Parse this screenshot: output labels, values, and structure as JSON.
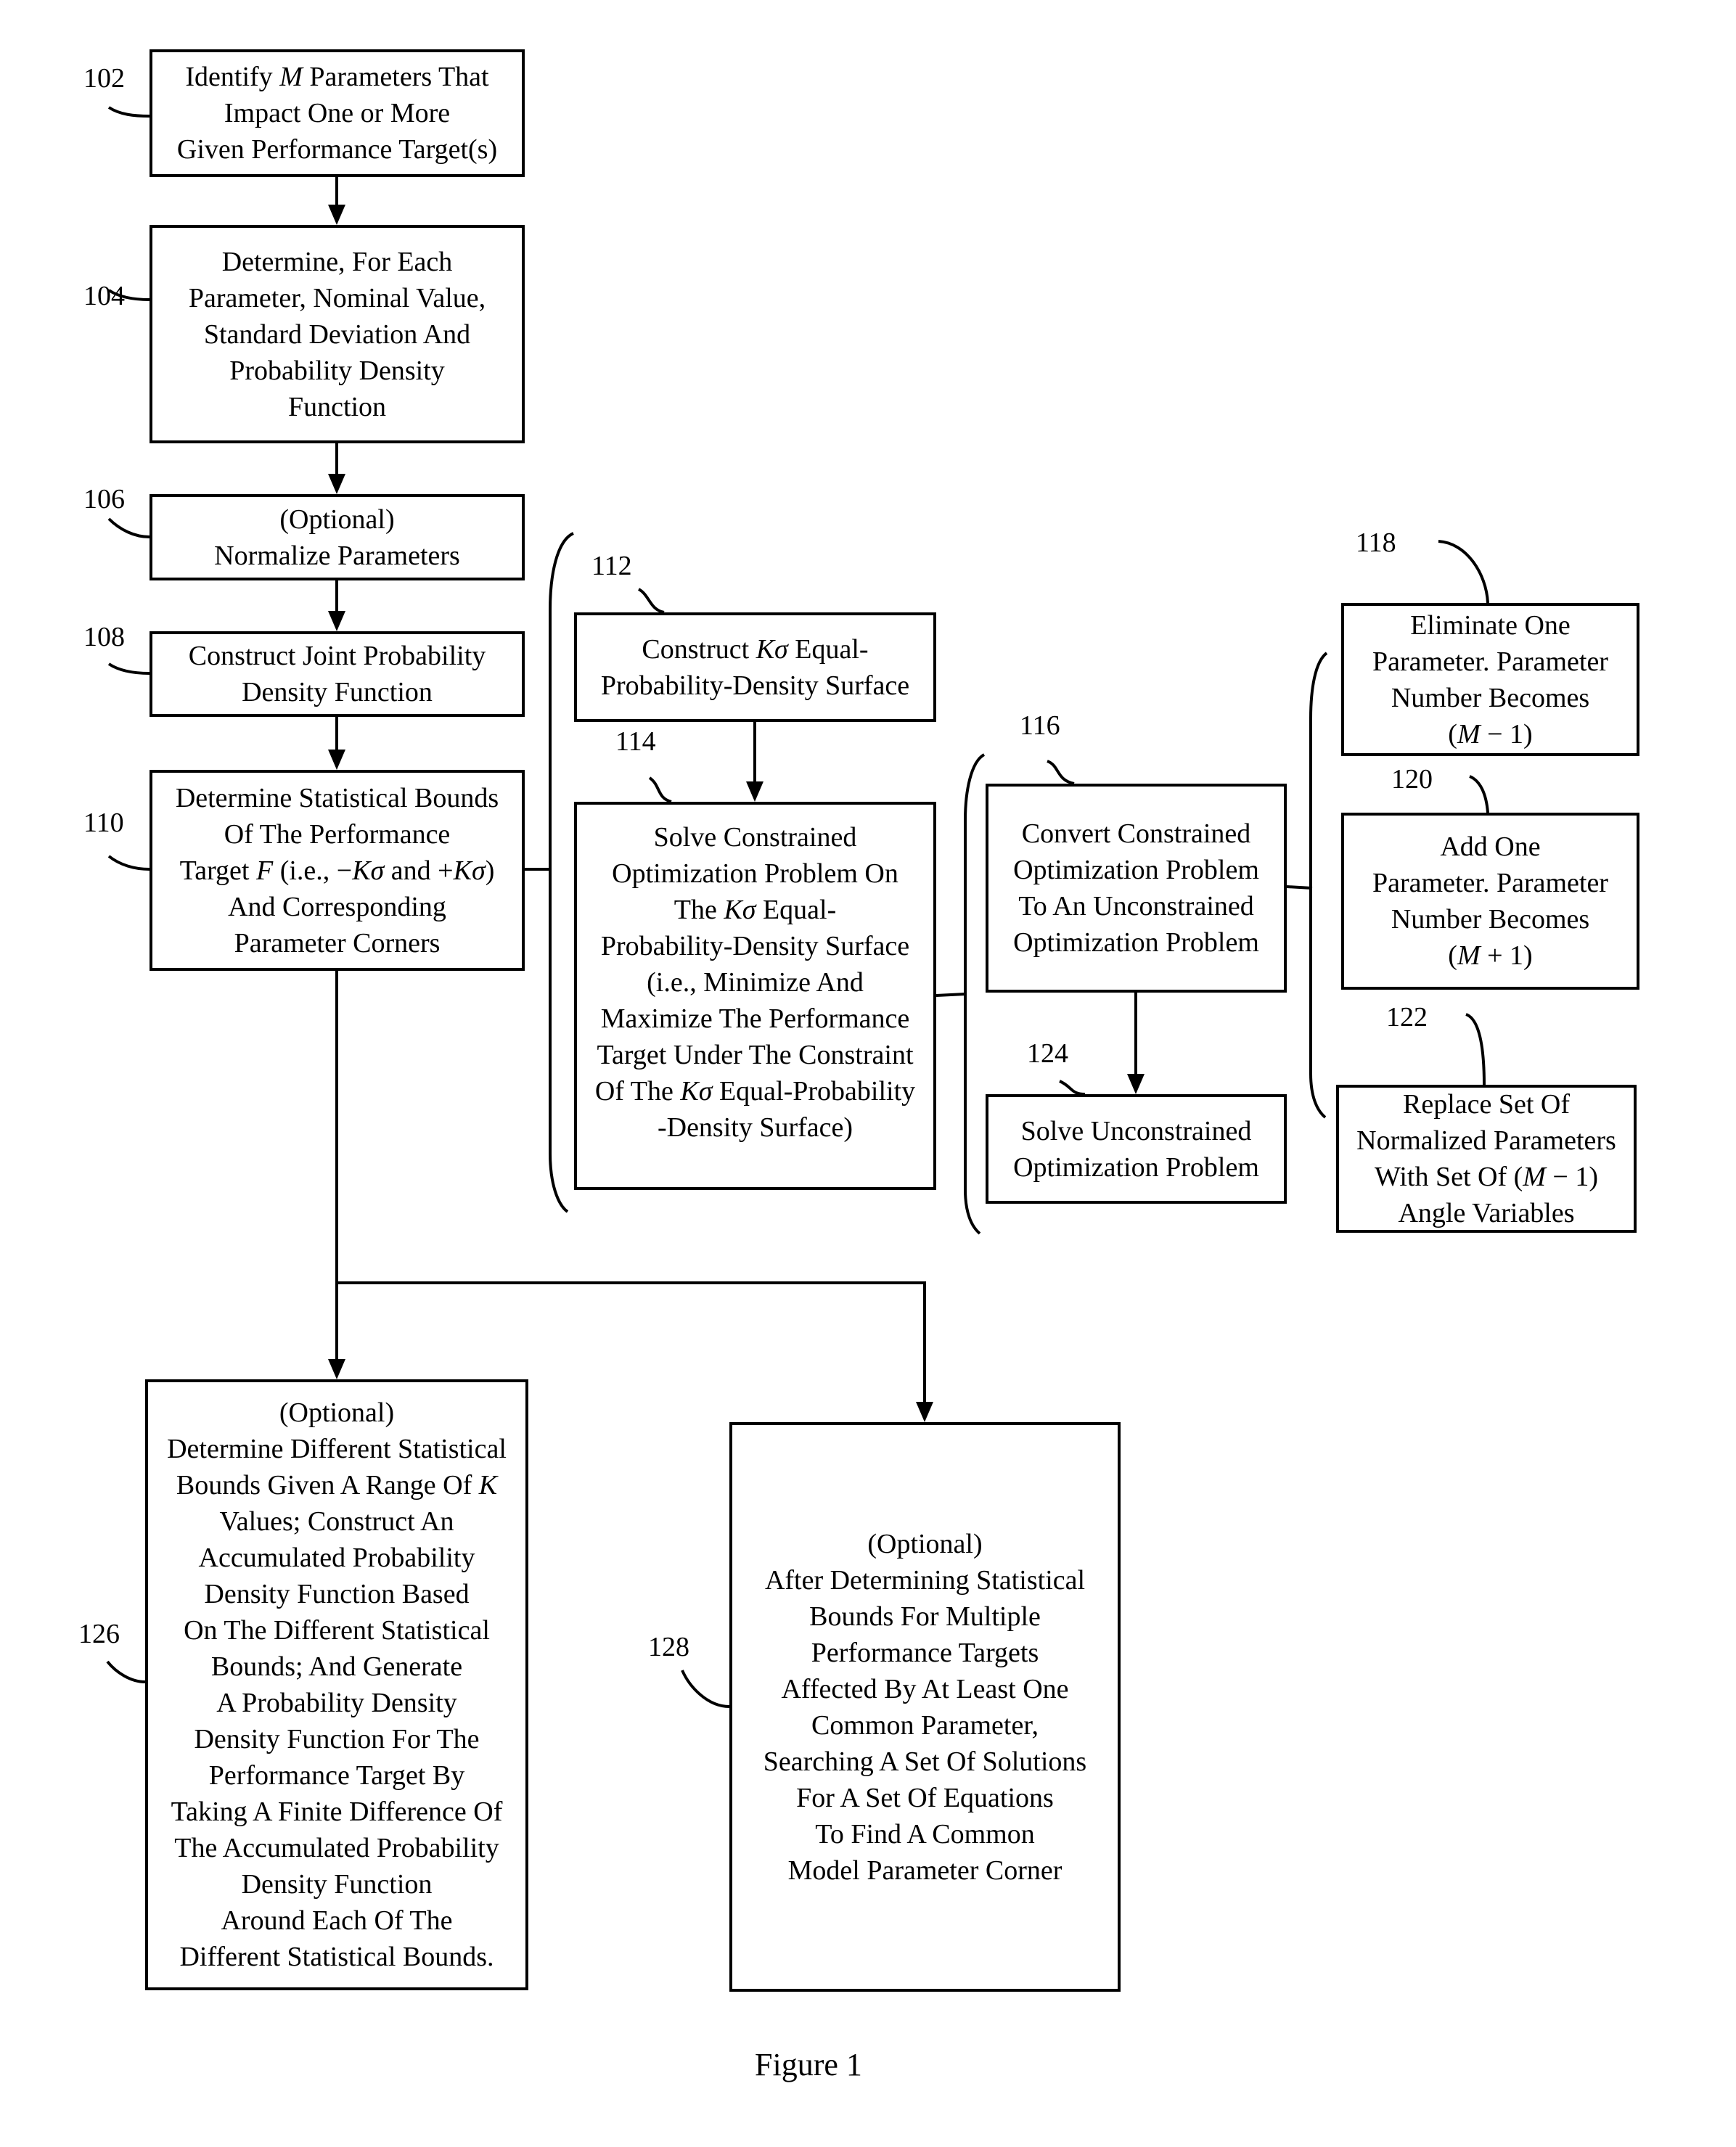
{
  "figure": {
    "caption": "Figure 1",
    "colors": {
      "ink": "#000000",
      "background": "#ffffff"
    }
  },
  "steps": {
    "s102": {
      "ref": "102",
      "lines": [
        "Identify M Parameters That",
        "Impact One or More",
        "Given Performance Target(s)"
      ]
    },
    "s104": {
      "ref": "104",
      "lines": [
        "Determine, For Each",
        "Parameter, Nominal Value,",
        "Standard Deviation And",
        "Probability Density",
        "Function"
      ]
    },
    "s106": {
      "ref": "106",
      "lines": [
        "(Optional)",
        "Normalize Parameters"
      ]
    },
    "s108": {
      "ref": "108",
      "lines": [
        "Construct Joint Probability",
        "Density Function"
      ]
    },
    "s110": {
      "ref": "110",
      "lines": [
        "Determine Statistical Bounds",
        "Of The Performance",
        "Target F (i.e., −Kσ and +Kσ)",
        "And Corresponding",
        "Parameter Corners"
      ]
    },
    "s112": {
      "ref": "112",
      "lines": [
        "Construct Kσ Equal-",
        "Probability-Density Surface"
      ]
    },
    "s114": {
      "ref": "114",
      "lines": [
        "Solve Constrained",
        "Optimization Problem On",
        "The Kσ Equal-",
        "Probability-Density Surface",
        "(i.e., Minimize And",
        "Maximize The Performance",
        "Target Under The Constraint",
        "Of The Kσ Equal-Probability",
        "-Density Surface)"
      ]
    },
    "s116": {
      "ref": "116",
      "lines": [
        "Convert Constrained",
        "Optimization Problem",
        "To An Unconstrained",
        "Optimization Problem"
      ]
    },
    "s118": {
      "ref": "118",
      "lines": [
        "Eliminate One",
        "Parameter. Parameter",
        "Number Becomes",
        "(M − 1)"
      ]
    },
    "s120": {
      "ref": "120",
      "lines": [
        "Add One",
        "Parameter.  Parameter",
        "Number Becomes",
        "(M + 1)"
      ]
    },
    "s122": {
      "ref": "122",
      "lines": [
        "Replace Set Of",
        "Normalized Parameters",
        "With Set Of (M − 1)",
        "Angle Variables"
      ]
    },
    "s124": {
      "ref": "124",
      "lines": [
        "Solve Unconstrained",
        "Optimization Problem"
      ]
    },
    "s126": {
      "ref": "126",
      "lines": [
        "(Optional)",
        "Determine Different Statistical",
        "Bounds Given A Range Of K",
        "Values; Construct An",
        "Accumulated Probability",
        "Density Function Based",
        "On The Different Statistical",
        "Bounds; And Generate",
        "A Probability Density",
        "Density Function For The",
        "Performance Target By",
        "Taking A Finite Difference Of",
        "The Accumulated Probability",
        "Density Function",
        "Around Each Of The",
        "Different Statistical Bounds."
      ]
    },
    "s128": {
      "ref": "128",
      "lines": [
        "(Optional)",
        "After Determining Statistical",
        "Bounds For Multiple",
        "Performance Targets",
        "Affected By At Least One",
        "Common Parameter,",
        "Searching A Set Of Solutions",
        "For A Set Of Equations",
        "To Find A Common",
        "Model Parameter Corner"
      ]
    }
  }
}
